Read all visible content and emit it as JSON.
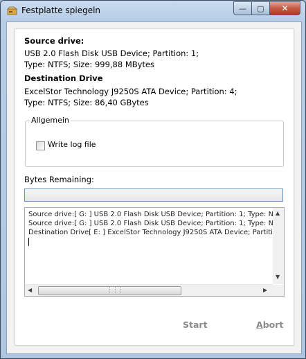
{
  "window": {
    "title": "Festplatte spiegeln"
  },
  "source": {
    "heading": "Source drive:",
    "line1": "USB 2.0 Flash Disk USB Device; Partition: 1;",
    "line2": "Type: NTFS; Size: 999,88 MBytes"
  },
  "destination": {
    "heading": "Destination Drive",
    "line1": "ExcelStor Technology J9250S ATA Device; Partition: 4;",
    "line2": "Type: NTFS; Size: 86,40 GBytes"
  },
  "group": {
    "title": "Allgemein",
    "write_log_label": "Write log file",
    "write_log_checked": false
  },
  "progress": {
    "label": "Bytes Remaining:",
    "value": 0
  },
  "log": {
    "lines": [
      "Source drive:[ G: ] USB 2.0 Flash Disk USB Device; Partition: 1; Type: NT",
      "Source drive:[ G: ] USB 2.0 Flash Disk USB Device; Partition: 1; Type: NT",
      "Destination Drive[ E: ] ExcelStor Technology J9250S ATA Device; Partitic"
    ]
  },
  "buttons": {
    "start": "Start",
    "abort_first": "A",
    "abort_rest": "bort"
  },
  "colors": {
    "title_bar": "#b7cde6",
    "close": "#c45a44",
    "disabled_text": "#8a8a8a",
    "progress_border": "#6b8fb8"
  },
  "icons": {
    "app": "drive-icon",
    "minimize": "minimize-icon",
    "maximize": "maximize-icon",
    "close": "close-icon"
  }
}
